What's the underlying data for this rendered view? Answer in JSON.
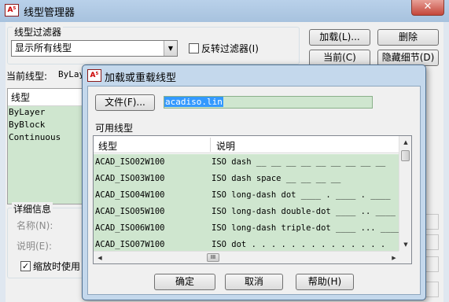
{
  "outer": {
    "app_icon": "A⁵",
    "title": "线型管理器",
    "close": "✕",
    "filter_group_label": "线型过滤器",
    "filter_value": "显示所有线型",
    "invert_filter_label": "反转过滤器(I)",
    "invert_filter_checked": false,
    "buttons": {
      "load": "加载(L)...",
      "delete": "删除",
      "current": "当前(C)",
      "hide_details": "隐藏细节(D)"
    },
    "current_linetype_label": "当前线型:",
    "current_linetype_value": "ByLay",
    "list_header": "线型",
    "list_items": [
      "ByLayer",
      "ByBlock",
      "Continuous"
    ],
    "details_group_label": "详细信息",
    "name_label": "名称(N):",
    "desc_label": "说明(E):",
    "scale_label": "缩放时使用",
    "scale_checked": true
  },
  "dialog": {
    "app_icon": "A⁵",
    "title": "加载或重载线型",
    "file_button": "文件(F)...",
    "file_value": "acadiso.lin",
    "available_label": "可用线型",
    "col_linetype": "线型",
    "col_desc": "说明",
    "rows": [
      {
        "name": "ACAD_ISO02W100",
        "desc": "ISO dash __ __ __ __ __ __ __ __ __"
      },
      {
        "name": "ACAD_ISO03W100",
        "desc": "ISO dash space __    __    __    __"
      },
      {
        "name": "ACAD_ISO04W100",
        "desc": "ISO long-dash dot ____ . ____ . ____"
      },
      {
        "name": "ACAD_ISO05W100",
        "desc": "ISO long-dash double-dot ____ .. ____"
      },
      {
        "name": "ACAD_ISO06W100",
        "desc": "ISO long-dash triple-dot ____ ... ____"
      },
      {
        "name": "ACAD_ISO07W100",
        "desc": "ISO dot . . . . . . . . . . . . . ."
      }
    ],
    "hscroll_thumb": "III",
    "ok": "确定",
    "cancel": "取消",
    "help": "帮助(H)"
  }
}
